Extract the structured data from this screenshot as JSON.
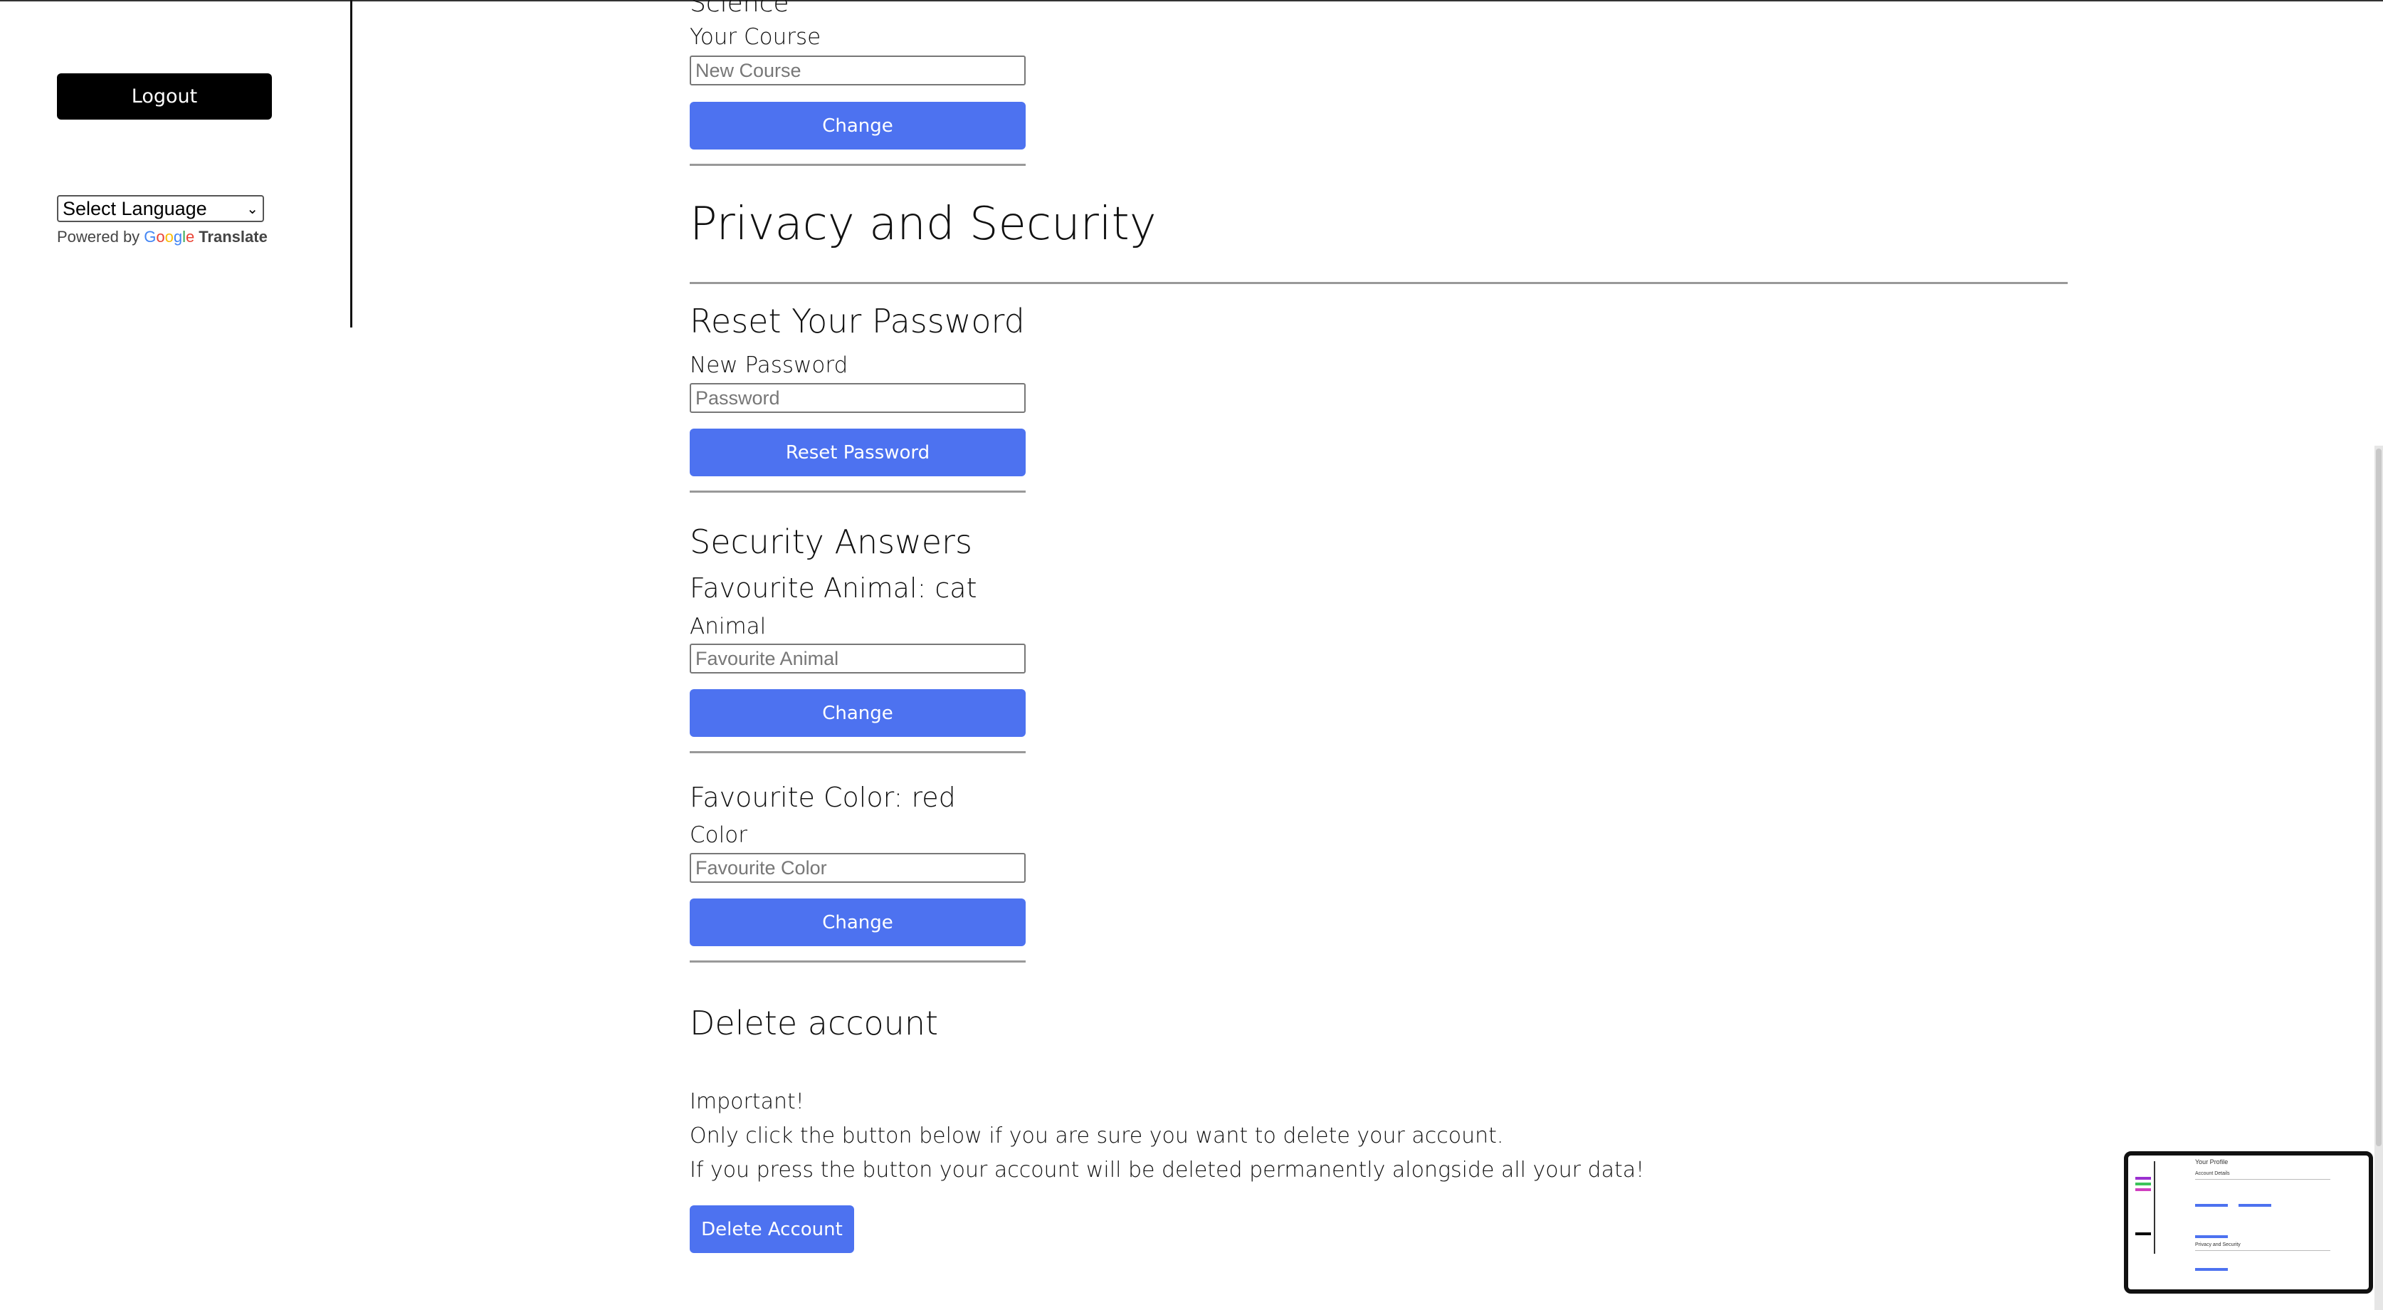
{
  "sidebar": {
    "logout_label": "Logout",
    "language_select": "Select Language",
    "powered_by": "Powered by",
    "google": "Google",
    "translate": "Translate"
  },
  "course": {
    "value_partial": "Science",
    "label": "Your Course",
    "placeholder": "New Course",
    "button": "Change"
  },
  "privacy": {
    "title": "Privacy and Security"
  },
  "password": {
    "title": "Reset Your Password",
    "label": "New Password",
    "placeholder": "Password",
    "button": "Reset Password"
  },
  "security": {
    "title": "Security Answers",
    "animal": {
      "current": "Favourite Animal: cat",
      "label": "Animal",
      "placeholder": "Favourite Animal",
      "button": "Change"
    },
    "color": {
      "current": "Favourite Color: red",
      "label": "Color",
      "placeholder": "Favourite Color",
      "button": "Change"
    }
  },
  "delete": {
    "title": "Delete account",
    "important": "Important!",
    "line1": "Only click the button below if you are sure you want to delete your account.",
    "line2": "If you press the button your account will be deleted permanently alongside all your data!",
    "button": "Delete Account"
  },
  "minimap": {
    "title": "Your Profile",
    "subtitle": "Account Details",
    "section2": "Privacy and Security"
  },
  "colors": {
    "primary_button": "#4d72f0",
    "logout_button": "#000000"
  }
}
